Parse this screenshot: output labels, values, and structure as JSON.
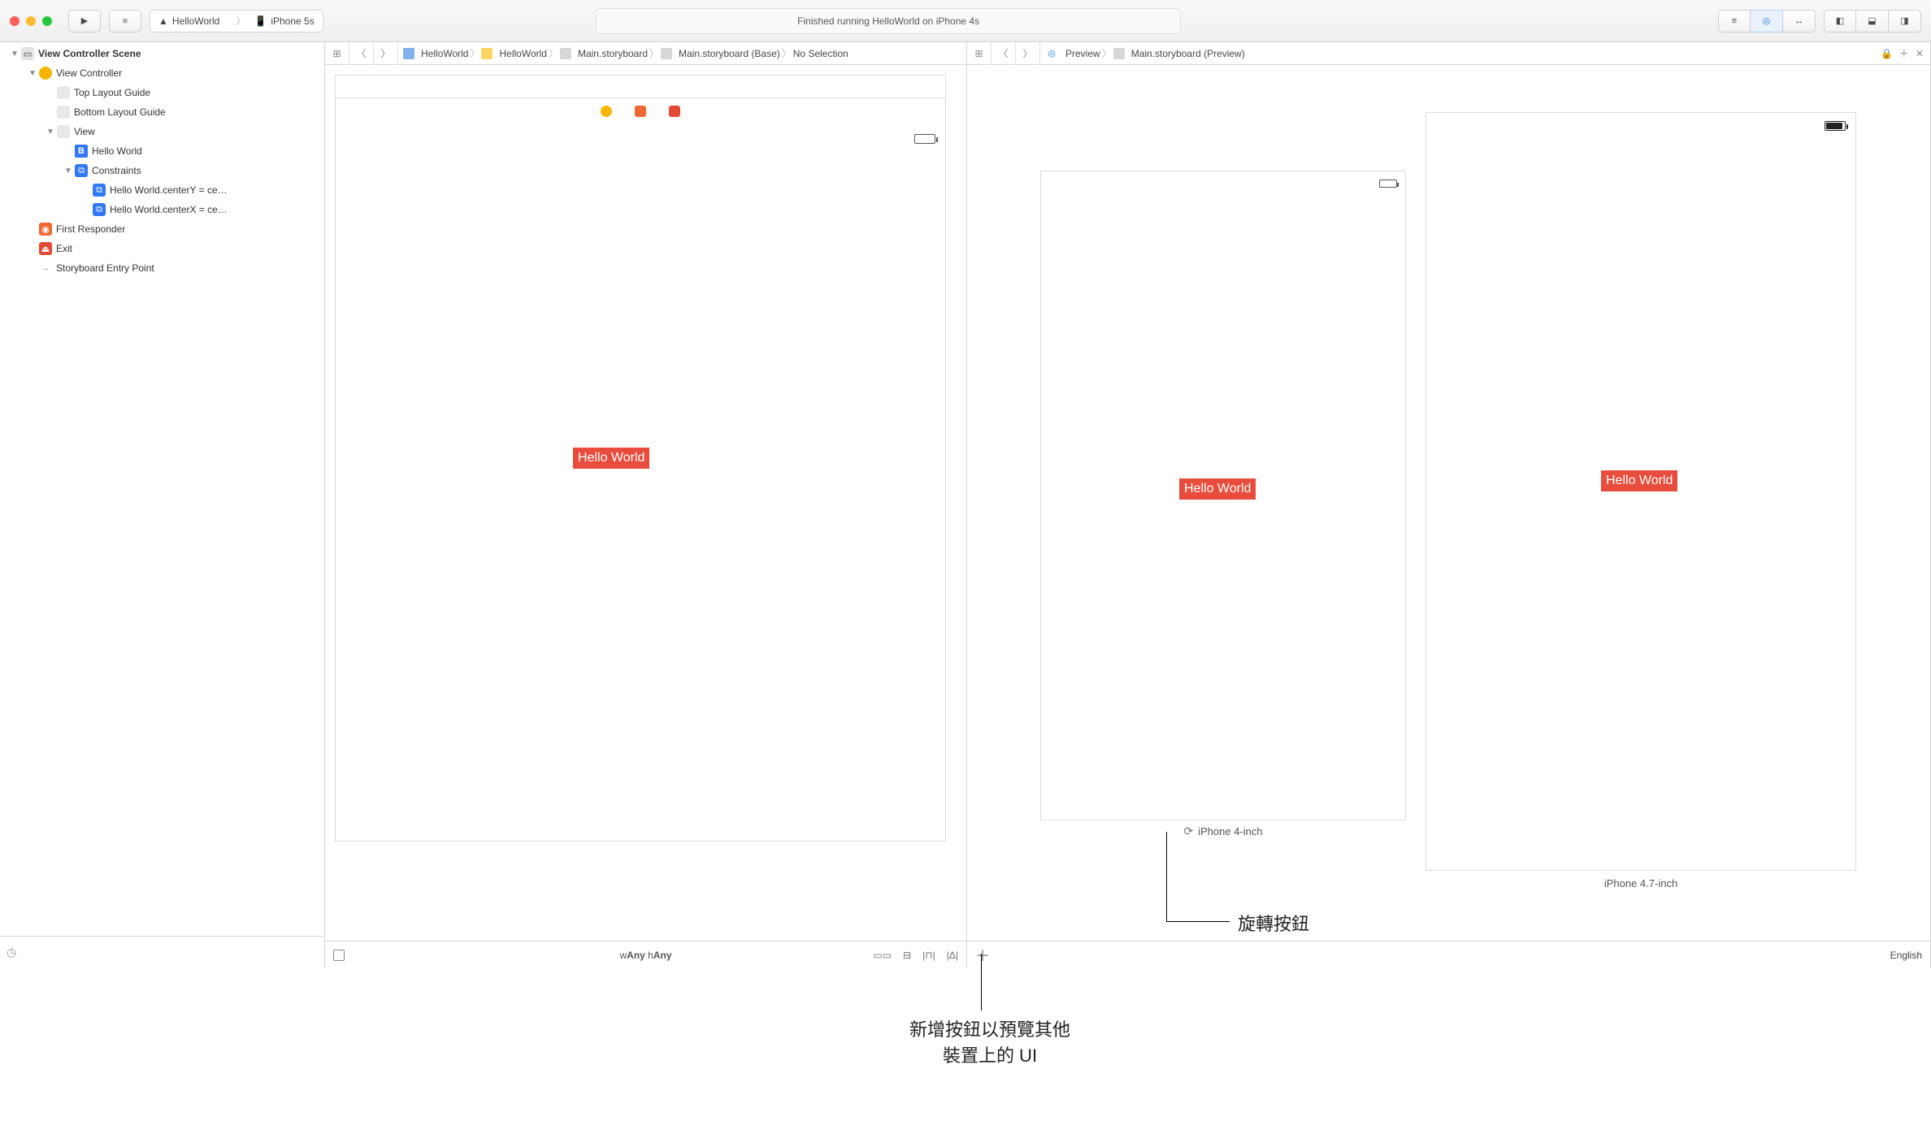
{
  "toolbar": {
    "scheme_target": "HelloWorld",
    "scheme_device": "iPhone 5s",
    "status": "Finished running HelloWorld on iPhone 4s"
  },
  "left_jumpbar": {
    "crumbs": [
      "HelloWorld",
      "HelloWorld",
      "Main.storyboard",
      "Main.storyboard (Base)",
      "No Selection"
    ]
  },
  "right_jumpbar": {
    "crumbs": [
      "Preview",
      "Main.storyboard (Preview)"
    ]
  },
  "outline": {
    "items": [
      {
        "indent": 0,
        "disclosure": "▼",
        "iconCls": "scene",
        "glyph": "▭",
        "label": "View Controller Scene",
        "strong": true
      },
      {
        "indent": 1,
        "disclosure": "▼",
        "iconCls": "vc",
        "glyph": "",
        "label": "View Controller"
      },
      {
        "indent": 2,
        "disclosure": "",
        "iconCls": "guide",
        "glyph": "",
        "label": "Top Layout Guide"
      },
      {
        "indent": 2,
        "disclosure": "",
        "iconCls": "guide",
        "glyph": "",
        "label": "Bottom Layout Guide"
      },
      {
        "indent": 2,
        "disclosure": "▼",
        "iconCls": "view",
        "glyph": "",
        "label": "View"
      },
      {
        "indent": 3,
        "disclosure": "",
        "iconCls": "label",
        "glyph": "B",
        "label": "Hello World"
      },
      {
        "indent": 3,
        "disclosure": "▼",
        "iconCls": "constraint",
        "glyph": "⧉",
        "label": "Constraints"
      },
      {
        "indent": 4,
        "disclosure": "",
        "iconCls": "constraint",
        "glyph": "⧉",
        "label": "Hello World.centerY = ce…"
      },
      {
        "indent": 4,
        "disclosure": "",
        "iconCls": "constraint",
        "glyph": "⧉",
        "label": "Hello World.centerX = ce…"
      },
      {
        "indent": 1,
        "disclosure": "",
        "iconCls": "fr",
        "glyph": "◉",
        "label": "First Responder"
      },
      {
        "indent": 1,
        "disclosure": "",
        "iconCls": "exit",
        "glyph": "⏏",
        "label": "Exit"
      },
      {
        "indent": 1,
        "disclosure": "",
        "iconCls": "entry",
        "glyph": "→",
        "label": "Storyboard Entry Point"
      }
    ]
  },
  "canvas_left": {
    "hello_text": "Hello World",
    "size_class": "wAny hAny"
  },
  "preview": {
    "hello_text": "Hello World",
    "device1_label": "iPhone 4-inch",
    "device2_label": "iPhone 4.7-inch",
    "language": "English"
  },
  "annotations": {
    "add_button_line1": "新增按鈕以預覽其他",
    "add_button_line2": "裝置上的 UI",
    "rotate_button": "旋轉按鈕"
  }
}
